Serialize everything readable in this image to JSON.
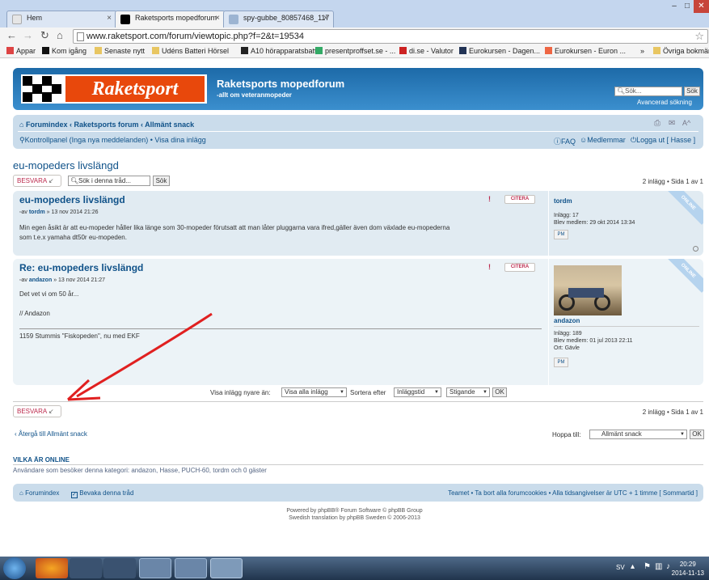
{
  "browser": {
    "tabs": [
      {
        "label": "Hem"
      },
      {
        "label": "Raketsports mopedforum"
      },
      {
        "label": "spy-gubbe_80857468_117"
      }
    ],
    "url": "www.raketsport.com/forum/viewtopic.php?f=2&t=19534",
    "bookmarks": [
      "Appar",
      "Kom igång",
      "Senaste nytt",
      "Udéns Batteri Hörsel",
      "A10 hörapparatsbatt...",
      "presentproffset.se - ...",
      "di.se - Valutor",
      "Eurokursen - Dagen...",
      "Eurokursen - Euron ...",
      "»",
      "Övriga bokmärken"
    ]
  },
  "header": {
    "logo_text": "Raketsport",
    "site_title": "Raketsports mopedforum",
    "site_desc": "-allt om veteranmopeder",
    "search_placeholder": "Sök...",
    "search_button": "Sök",
    "advanced_search": "Avancerad sökning"
  },
  "navbar": {
    "breadcrumb": "Forumindex ‹ Raketsports forum ‹ Allmänt snack",
    "control_panel": "Kontrollpanel (Inga nya meddelanden)",
    "view_posts": "• Visa dina inlägg",
    "faq": "FAQ",
    "members": "Medlemmar",
    "logout": "Logga ut [ Hasse ]"
  },
  "topic": {
    "title": "eu-mopeders livslängd",
    "reply_button": "BESVARA",
    "search_placeholder": "Sök i denna tråd...",
    "search_button": "Sök",
    "pagination": "2 inlägg • Sida 1 av 1"
  },
  "posts": [
    {
      "title": "eu-mopeders livslängd",
      "meta_prefix": "av",
      "author": "tordm",
      "date": "» 13 nov 2014 21:26",
      "body_line1": "Min egen åsikt är att eu-mopeder håller lika länge som 30-mopeder förutsatt att man låter pluggarna vara ifred,gäller även dom växlade eu-mopederna",
      "body_line2": "som t.e.x yamaha dt50r eu-mopeden.",
      "quote": "CITERA",
      "profile_name": "tordm",
      "profile_posts": "Inlägg: 17",
      "profile_joined": "Blev medlem: 29 okt 2014 13:34",
      "profile_location": "",
      "pm": "PM",
      "online": "ONLINE"
    },
    {
      "title": "Re: eu-mopeders livslängd",
      "meta_prefix": "av",
      "author": "andazon",
      "date": "» 13 nov 2014 21:27",
      "body_line1": "Det vet vi om 50 år...",
      "body_line2": "// Andazon",
      "signature": "1159 Stummis \"Fiskopeden\", nu med EKF",
      "quote": "CITERA",
      "profile_name": "andazon",
      "profile_posts": "Inlägg: 189",
      "profile_joined": "Blev medlem: 01 jul 2013 22:11",
      "profile_location": "Ort: Gävle",
      "pm": "PM",
      "online": "ONLINE"
    }
  ],
  "sort": {
    "show_label": "Visa inlägg nyare än:",
    "show_value": "Visa alla inlägg",
    "sort_label": "Sortera efter",
    "sort_value": "Inläggstid",
    "order_value": "Stigande",
    "ok": "OK"
  },
  "bottom": {
    "reply_button": "BESVARA",
    "pagination": "2 inlägg • Sida 1 av 1",
    "back_link": "Återgå till Allmänt snack",
    "jump_label": "Hoppa till:",
    "jump_value": "Allmänt snack",
    "ok": "OK"
  },
  "online": {
    "heading": "VILKA ÄR ONLINE",
    "text": "Användare som besöker denna kategori: andazon, Hasse, PUCH-60, tordm och 0 gäster"
  },
  "footer": {
    "forumindex": "Forumindex",
    "watch": "Bevaka denna tråd",
    "right": "Teamet • Ta bort alla forumcookies • Alla tidsangivelser är UTC + 1 timme [ Sommartid ]",
    "powered": "Powered by phpBB® Forum Software © phpBB Group",
    "translation": "Swedish translation by phpBB Sweden © 2006-2013"
  },
  "taskbar": {
    "lang": "SV",
    "time": "20:29",
    "date": "2014-11-13"
  }
}
